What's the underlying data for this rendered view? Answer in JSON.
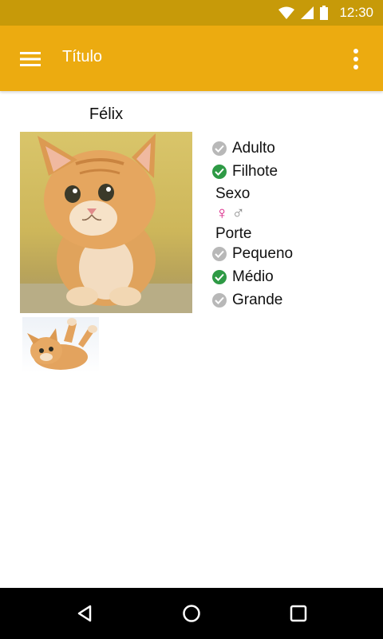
{
  "status_bar": {
    "time": "12:30"
  },
  "app_bar": {
    "title": "Título"
  },
  "pet": {
    "name": "Félix",
    "age_options": [
      {
        "label": "Adulto",
        "checked": false
      },
      {
        "label": "Filhote",
        "checked": true
      }
    ],
    "sex_label": "Sexo",
    "sex_symbols": [
      "♀",
      "♂"
    ],
    "size_label": "Porte",
    "size_options": [
      {
        "label": "Pequeno",
        "checked": false
      },
      {
        "label": "Médio",
        "checked": true
      },
      {
        "label": "Grande",
        "checked": false
      }
    ]
  },
  "colors": {
    "status_bar": "#c79a09",
    "app_bar": "#ecab10",
    "checked": "#2e9a45",
    "unchecked": "#b8b8b8",
    "female": "#d6157e",
    "male": "#8a8a8a"
  }
}
